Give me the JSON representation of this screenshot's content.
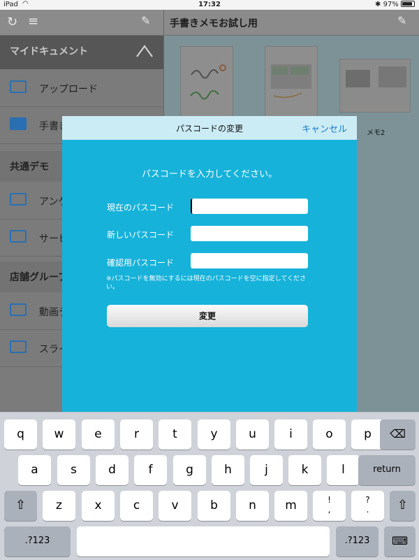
{
  "status_bar": {
    "carrier": "iPad",
    "time": "17:32",
    "battery": "97%"
  },
  "sidebar": {
    "sections": [
      {
        "label": "マイドキュメント",
        "items": [
          {
            "label": "アップロード",
            "open": false
          },
          {
            "label": "手書き",
            "open": true
          }
        ]
      },
      {
        "label": "共通デモ",
        "items": [
          {
            "label": "アンケ",
            "open": false
          },
          {
            "label": "サービ",
            "open": false
          }
        ]
      },
      {
        "label": "店舗グループ",
        "items": [
          {
            "label": "動画デ",
            "open": false
          },
          {
            "label": "スライ",
            "open": false
          }
        ]
      }
    ]
  },
  "main": {
    "title": "手書きメモお試し用",
    "thumb_label": "メモ2"
  },
  "modal": {
    "title": "パスコードの変更",
    "cancel_label": "キャンセル",
    "instruction": "パスコードを入力してください。",
    "fields": [
      {
        "label": "現在のパスコード",
        "value": ""
      },
      {
        "label": "新しいパスコード",
        "value": ""
      },
      {
        "label": "確認用パスコード",
        "value": ""
      }
    ],
    "note": "※パスコードを無効にするには現在のパスコードを空に指定してください。",
    "submit_label": "変更"
  },
  "keyboard": {
    "row1": [
      "q",
      "w",
      "e",
      "r",
      "t",
      "y",
      "u",
      "i",
      "o",
      "p"
    ],
    "row2": [
      "a",
      "s",
      "d",
      "f",
      "g",
      "h",
      "j",
      "k",
      "l"
    ],
    "row3": [
      "z",
      "x",
      "c",
      "v",
      "b",
      "n",
      "m"
    ],
    "exclaim": "!",
    "comma": ",",
    "question": "?",
    "period": ".",
    "return_label": "return",
    "numbers_label": ".?123"
  }
}
